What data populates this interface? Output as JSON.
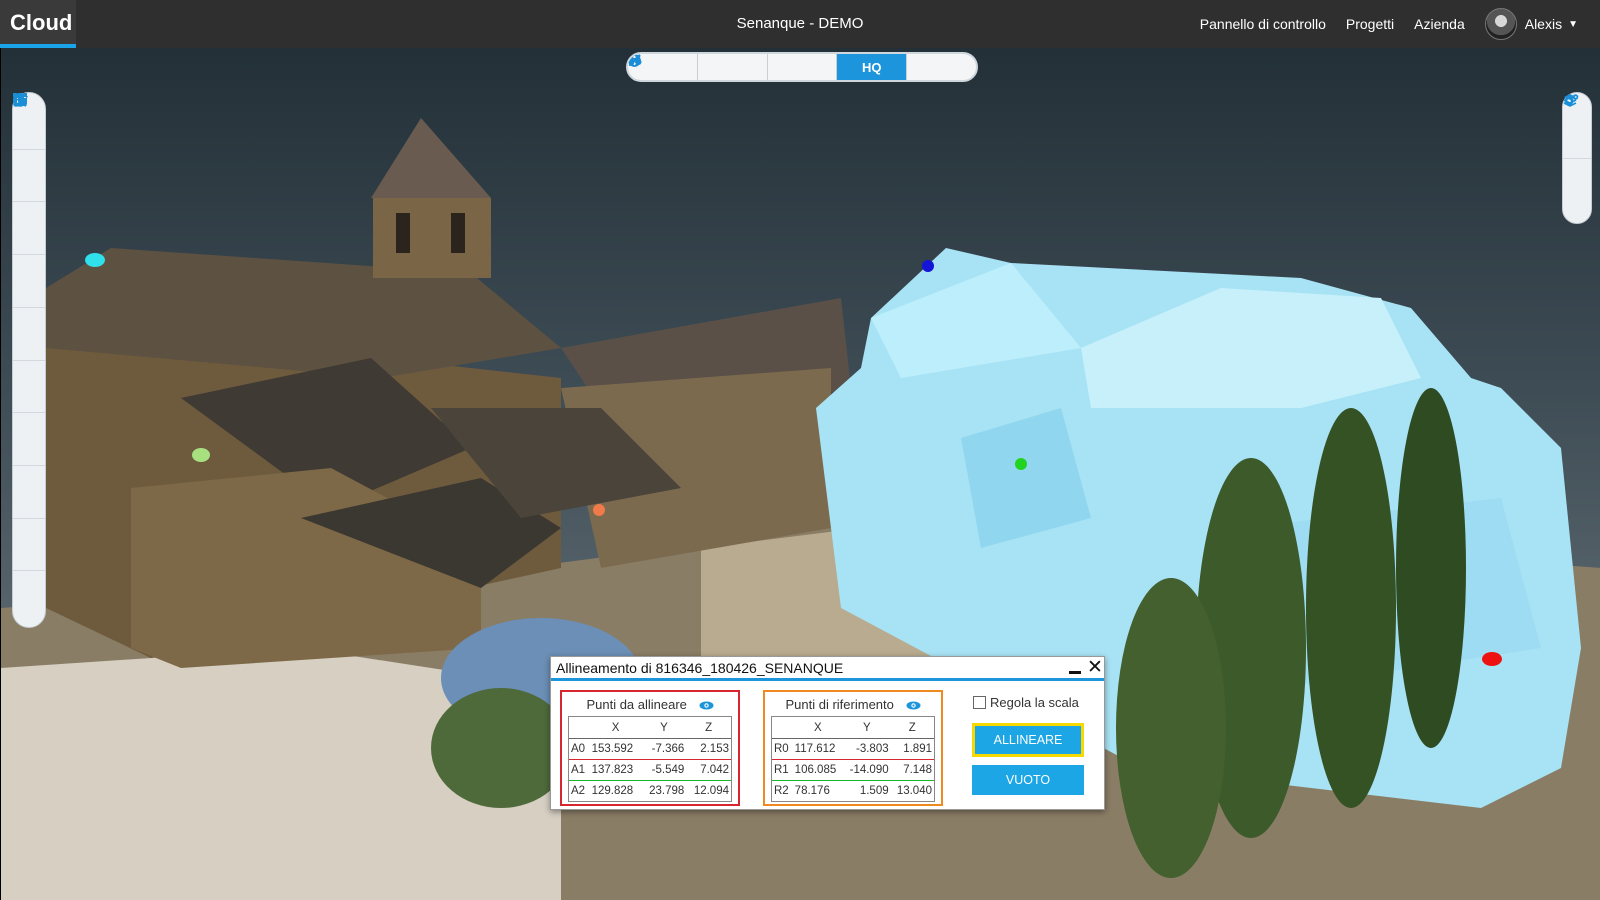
{
  "app": {
    "logo": "Cloud",
    "title": "Senanque - DEMO"
  },
  "nav": {
    "control_panel": "Pannello di controllo",
    "projects": "Progetti",
    "company": "Azienda",
    "user": "Alexis"
  },
  "render_bar": {
    "hq_label": "HQ"
  },
  "dialog": {
    "title": "Allineamento di 816346_180426_SENANQUE",
    "align_points": {
      "title": "Punti da allineare",
      "headers": [
        "X",
        "Y",
        "Z"
      ],
      "rows": [
        {
          "label": "A0",
          "x": "153.592",
          "y": "-7.366",
          "z": "2.153"
        },
        {
          "label": "A1",
          "x": "137.823",
          "y": "-5.549",
          "z": "7.042"
        },
        {
          "label": "A2",
          "x": "129.828",
          "y": "23.798",
          "z": "12.094"
        }
      ]
    },
    "ref_points": {
      "title": "Punti di riferimento",
      "headers": [
        "X",
        "Y",
        "Z"
      ],
      "rows": [
        {
          "label": "R0",
          "x": "117.612",
          "y": "-3.803",
          "z": "1.891"
        },
        {
          "label": "R1",
          "x": "106.085",
          "y": "-14.090",
          "z": "7.148"
        },
        {
          "label": "R2",
          "x": "78.176",
          "y": "1.509",
          "z": "13.040"
        }
      ]
    },
    "scale_label": "Regola la scala",
    "align_button": "ALLINEARE",
    "clear_button": "VUOTO"
  },
  "colors": {
    "accent": "#1c95dc",
    "align_box": "#d7262f",
    "ref_box": "#ee8a21",
    "model": "#a8e3f5"
  }
}
